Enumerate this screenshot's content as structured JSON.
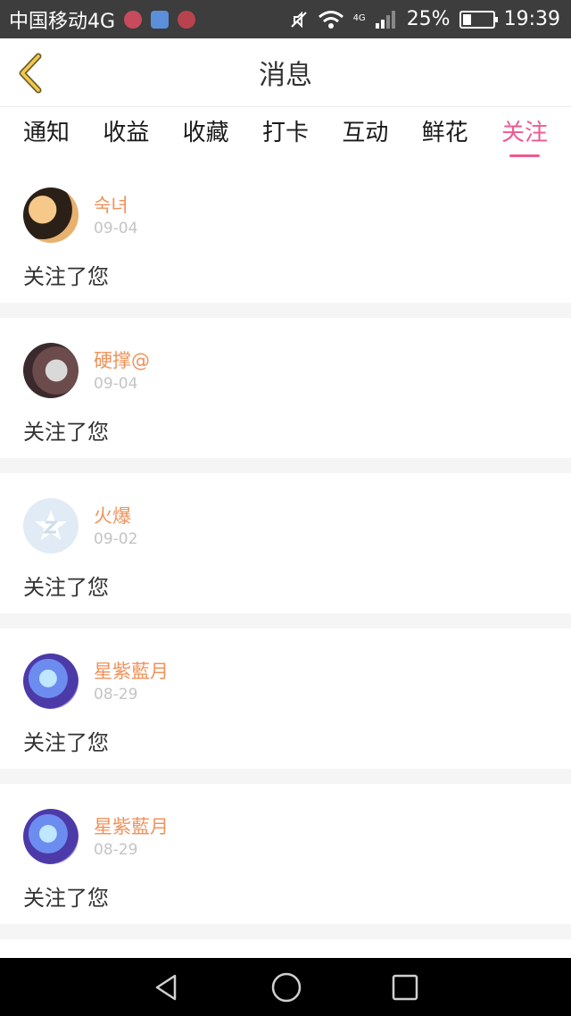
{
  "status": {
    "carrier": "中国移动4G",
    "network_small": "4G",
    "battery_pct": "25%",
    "battery_level": 0.25,
    "time": "19:39"
  },
  "header": {
    "title": "消息",
    "accent_color": "#ee5a91",
    "name_color": "#f0925a"
  },
  "tabs": [
    {
      "label": "通知"
    },
    {
      "label": "收益"
    },
    {
      "label": "收藏"
    },
    {
      "label": "打卡"
    },
    {
      "label": "互动"
    },
    {
      "label": "鲜花"
    },
    {
      "label": "关注",
      "active": true
    }
  ],
  "items": [
    {
      "name": "숙녀",
      "date": "09-04",
      "message": "关注了您"
    },
    {
      "name": "硬撑@",
      "date": "09-04",
      "message": "关注了您"
    },
    {
      "name": "火爆",
      "date": "09-02",
      "message": "关注了您"
    },
    {
      "name": "星紫藍月",
      "date": "08-29",
      "message": "关注了您"
    },
    {
      "name": "星紫藍月",
      "date": "08-29",
      "message": "关注了您"
    }
  ]
}
